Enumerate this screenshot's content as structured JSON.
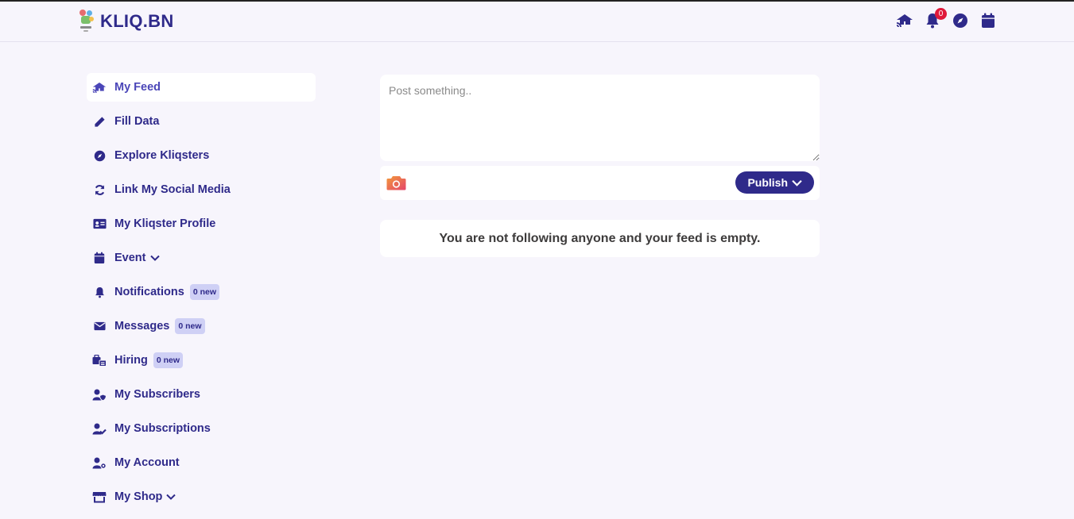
{
  "brand": {
    "name": "KLIQ.BN"
  },
  "topbar": {
    "notification_count": "0"
  },
  "sidebar": {
    "items": [
      {
        "label": "My Feed",
        "icon": "feed-icon",
        "active": true
      },
      {
        "label": "Fill Data",
        "icon": "pencil-icon"
      },
      {
        "label": "Explore Kliqsters",
        "icon": "compass-icon"
      },
      {
        "label": "Link My Social Media",
        "icon": "sync-icon"
      },
      {
        "label": "My Kliqster Profile",
        "icon": "id-card-icon"
      },
      {
        "label": "Event",
        "icon": "calendar-icon"
      },
      {
        "label": "Notifications",
        "icon": "bell-icon",
        "badge": "0 new"
      },
      {
        "label": "Messages",
        "icon": "envelope-icon",
        "badge": "0 new"
      },
      {
        "label": "Hiring",
        "icon": "hiring-icon",
        "badge": "0 new"
      },
      {
        "label": "My Subscribers",
        "icon": "user-shield-icon"
      },
      {
        "label": "My Subscriptions",
        "icon": "user-check-icon"
      },
      {
        "label": "My Account",
        "icon": "user-gear-icon"
      },
      {
        "label": "My Shop",
        "icon": "shop-icon"
      }
    ]
  },
  "composer": {
    "placeholder": "Post something..",
    "publish_label": "Publish"
  },
  "feed": {
    "empty_message": "You are not following anyone and your feed is empty."
  },
  "colors": {
    "primary": "#2f2a8a",
    "background": "#f7f5fc",
    "badge_red": "#e0193a",
    "badge_new_bg": "#cfd0f5"
  }
}
